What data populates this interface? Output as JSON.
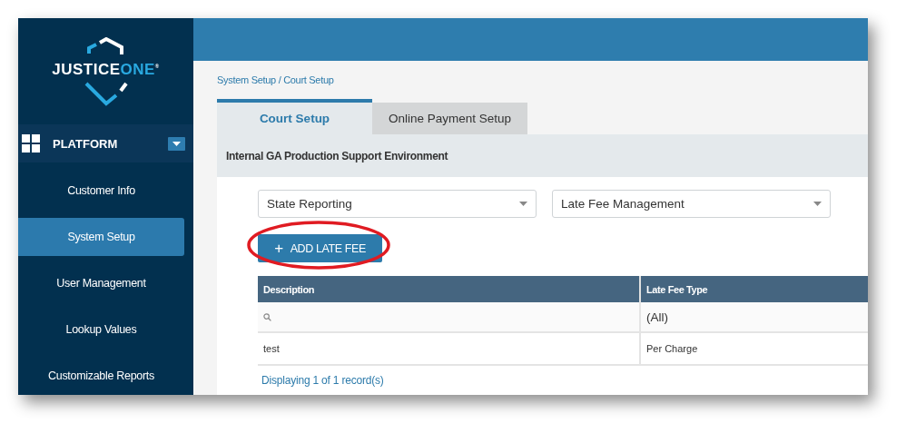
{
  "logo": {
    "primary": "JUSTICE",
    "accent": "ONE",
    "mark": "®"
  },
  "sidebar": {
    "section": {
      "label": "PLATFORM",
      "expanded": true
    },
    "items": [
      {
        "label": "Customer Info",
        "selected": false
      },
      {
        "label": "System Setup",
        "selected": true
      },
      {
        "label": "User Management",
        "selected": false
      },
      {
        "label": "Lookup Values",
        "selected": false
      },
      {
        "label": "Customizable Reports",
        "selected": false
      }
    ]
  },
  "breadcrumb": "System Setup / Court Setup",
  "tabs": [
    {
      "label": "Court Setup",
      "selected": true
    },
    {
      "label": "Online Payment Setup",
      "selected": false
    }
  ],
  "environment": "Internal GA Production Support Environment",
  "dropdowns": [
    {
      "value": "State Reporting"
    },
    {
      "value": "Late Fee Management"
    }
  ],
  "add_button": {
    "icon": "+",
    "label": "ADD LATE FEE"
  },
  "highlight": {
    "kind": "ellipse"
  },
  "table": {
    "columns": [
      "Description",
      "Late Fee Type"
    ],
    "filters": [
      {
        "kind": "search"
      },
      {
        "kind": "text",
        "value": "(All)"
      }
    ],
    "rows": [
      [
        "test",
        "Per Charge"
      ]
    ]
  },
  "footer": "Displaying 1 of 1 record(s)"
}
